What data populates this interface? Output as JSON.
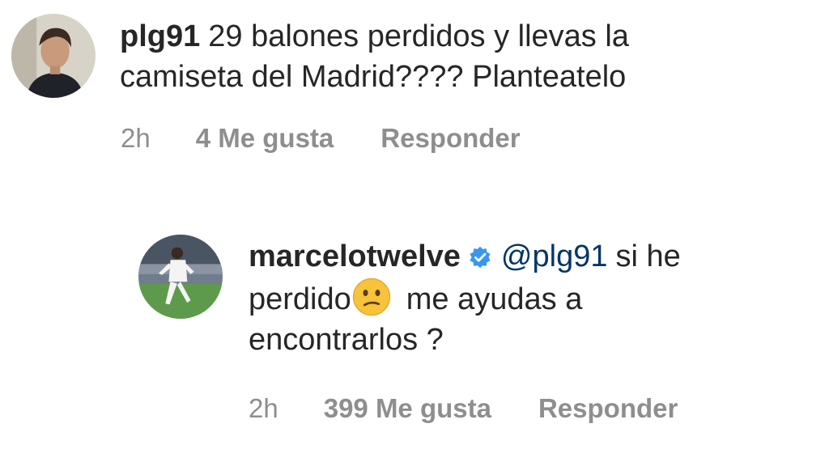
{
  "comments": [
    {
      "username": "plg91",
      "text_line1": "29 balones perdidos y llevas la",
      "text_line2": "camiseta del Madrid???? Planteatelo",
      "time": "2h",
      "likes": "4 Me gusta",
      "reply": "Responder",
      "avatar_icon": "user-avatar-icon"
    },
    {
      "username": "marcelotwelve",
      "verified_icon": "verified-badge-icon",
      "mention": "@plg91",
      "text_part1": "si he",
      "text_part2": "perdido",
      "emoji_icon": "confused-face-emoji",
      "text_part3": "me ayudas a",
      "text_part4": "encontrarlos ?",
      "time": "2h",
      "likes": "399 Me gusta",
      "reply": "Responder",
      "avatar_icon": "player-avatar-icon"
    }
  ],
  "colors": {
    "text": "#262626",
    "meta": "#8e8e8e",
    "mention": "#003569",
    "verified": "#3897f0"
  }
}
